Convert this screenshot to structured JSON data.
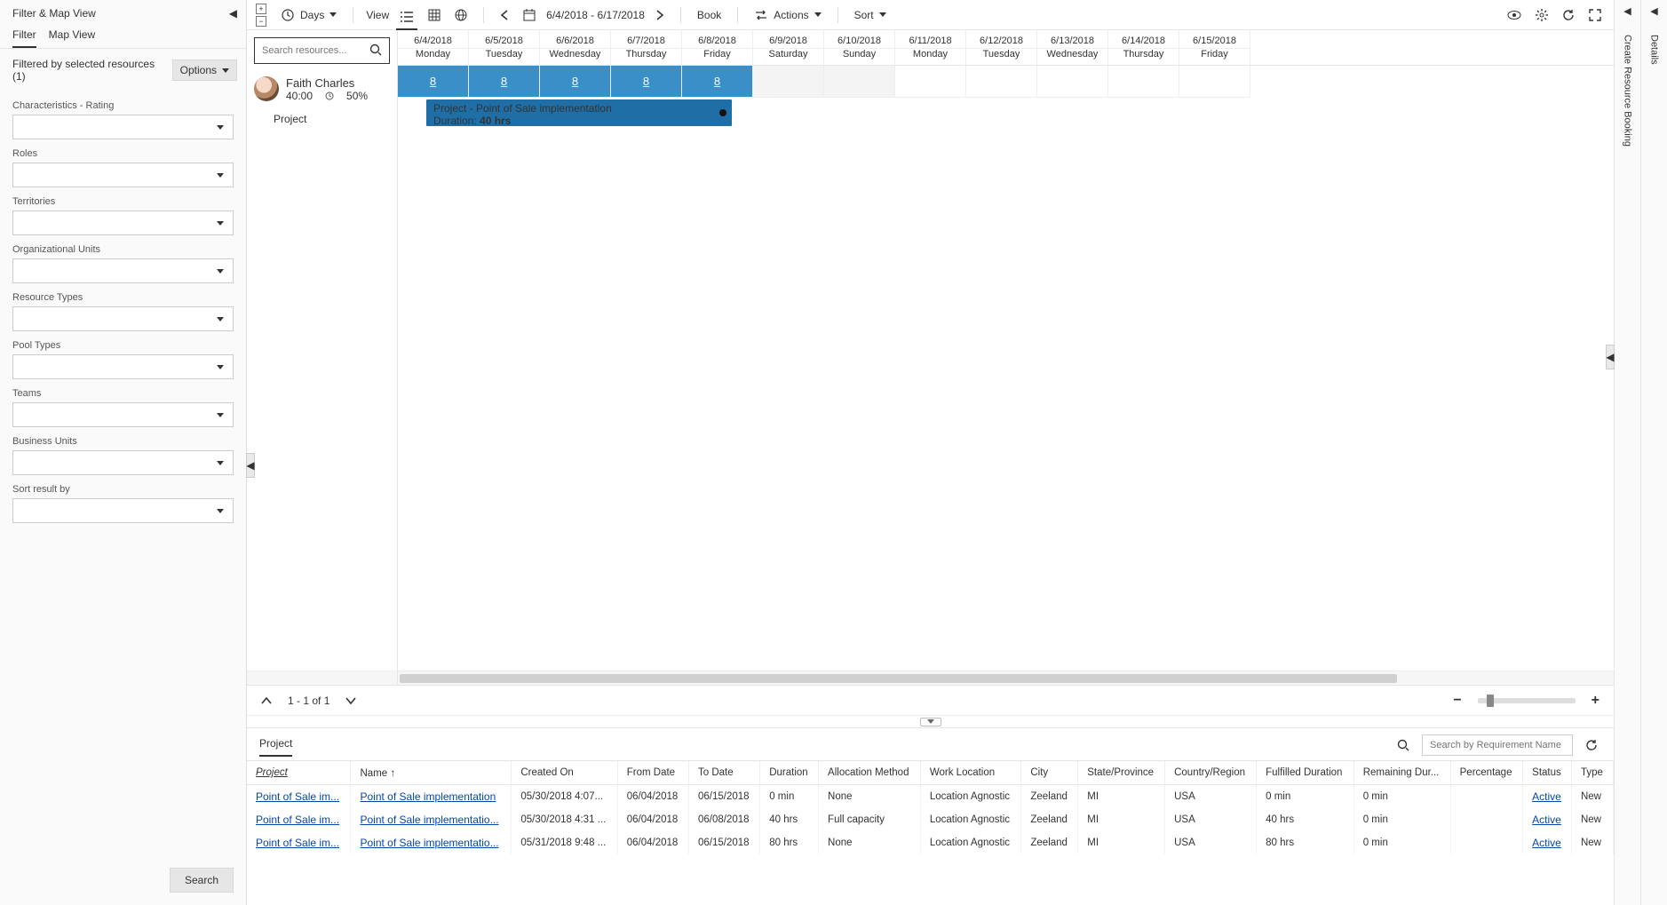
{
  "leftPanel": {
    "title": "Filter & Map View",
    "tabs": [
      "Filter",
      "Map View"
    ],
    "activeTab": 0,
    "summary": "Filtered by selected resources (1)",
    "optionsLabel": "Options",
    "fields": [
      {
        "label": "Characteristics - Rating"
      },
      {
        "label": "Roles"
      },
      {
        "label": "Territories"
      },
      {
        "label": "Organizational Units"
      },
      {
        "label": "Resource Types"
      },
      {
        "label": "Pool Types"
      },
      {
        "label": "Teams"
      },
      {
        "label": "Business Units"
      },
      {
        "label": "Sort result by"
      }
    ],
    "searchBtn": "Search"
  },
  "toolbar": {
    "timescaleLabel": "Days",
    "viewLabel": "View",
    "dateRange": "6/4/2018 - 6/17/2018",
    "bookLabel": "Book",
    "actionsLabel": "Actions",
    "sortLabel": "Sort"
  },
  "resourceSearchPlaceholder": "Search resources...",
  "resource": {
    "name": "Faith Charles",
    "hours": "40:00",
    "percent": "50%",
    "sub": "Project"
  },
  "days": [
    {
      "date": "6/4/2018",
      "name": "Monday",
      "alloc": "8",
      "blue": true
    },
    {
      "date": "6/5/2018",
      "name": "Tuesday",
      "alloc": "8",
      "blue": true
    },
    {
      "date": "6/6/2018",
      "name": "Wednesday",
      "alloc": "8",
      "blue": true
    },
    {
      "date": "6/7/2018",
      "name": "Thursday",
      "alloc": "8",
      "blue": true
    },
    {
      "date": "6/8/2018",
      "name": "Friday",
      "alloc": "8",
      "blue": true
    },
    {
      "date": "6/9/2018",
      "name": "Saturday",
      "alloc": "",
      "wk": true
    },
    {
      "date": "6/10/2018",
      "name": "Sunday",
      "alloc": "",
      "wk": true
    },
    {
      "date": "6/11/2018",
      "name": "Monday",
      "alloc": ""
    },
    {
      "date": "6/12/2018",
      "name": "Tuesday",
      "alloc": ""
    },
    {
      "date": "6/13/2018",
      "name": "Wednesday",
      "alloc": ""
    },
    {
      "date": "6/14/2018",
      "name": "Thursday",
      "alloc": ""
    },
    {
      "date": "6/15/2018",
      "name": "Friday",
      "alloc": ""
    }
  ],
  "booking": {
    "title": "Project - Point of Sale implementation",
    "durationLabel": "Duration:",
    "duration": "40 hrs",
    "startCol": 0,
    "spanCols": 4.3,
    "offsetPx": 32
  },
  "statusBar": {
    "pager": "1 - 1 of 1"
  },
  "rightRail": {
    "details": "Details",
    "create": "Create Resource Booking"
  },
  "bottom": {
    "tab": "Project",
    "searchPlaceholder": "Search by Requirement Name",
    "columns": [
      "Project",
      "Name",
      "Created On",
      "From Date",
      "To Date",
      "Duration",
      "Allocation Method",
      "Work Location",
      "City",
      "State/Province",
      "Country/Region",
      "Fulfilled Duration",
      "Remaining Dur...",
      "Percentage",
      "Status",
      "Type"
    ],
    "sortedCol": 0,
    "nameSortAsc": true,
    "rows": [
      {
        "project": "Point of Sale im...",
        "name": "Point of Sale implementation",
        "created": "05/30/2018 4:07...",
        "from": "06/04/2018",
        "to": "06/15/2018",
        "dur": "0 min",
        "alloc": "None",
        "loc": "Location Agnostic",
        "city": "Zeeland",
        "state": "MI",
        "country": "USA",
        "fdur": "0 min",
        "rdur": "0 min",
        "pct": "",
        "status": "Active",
        "type": "New"
      },
      {
        "project": "Point of Sale im...",
        "name": "Point of Sale implementatio...",
        "created": "05/30/2018 4:31 ...",
        "from": "06/04/2018",
        "to": "06/08/2018",
        "dur": "40 hrs",
        "alloc": "Full capacity",
        "loc": "Location Agnostic",
        "city": "Zeeland",
        "state": "MI",
        "country": "USA",
        "fdur": "40 hrs",
        "rdur": "0 min",
        "pct": "",
        "status": "Active",
        "type": "New"
      },
      {
        "project": "Point of Sale im...",
        "name": "Point of Sale implementatio...",
        "created": "05/31/2018 9:48 ...",
        "from": "06/04/2018",
        "to": "06/15/2018",
        "dur": "80 hrs",
        "alloc": "None",
        "loc": "Location Agnostic",
        "city": "Zeeland",
        "state": "MI",
        "country": "USA",
        "fdur": "80 hrs",
        "rdur": "0 min",
        "pct": "",
        "status": "Active",
        "type": "New"
      }
    ]
  }
}
